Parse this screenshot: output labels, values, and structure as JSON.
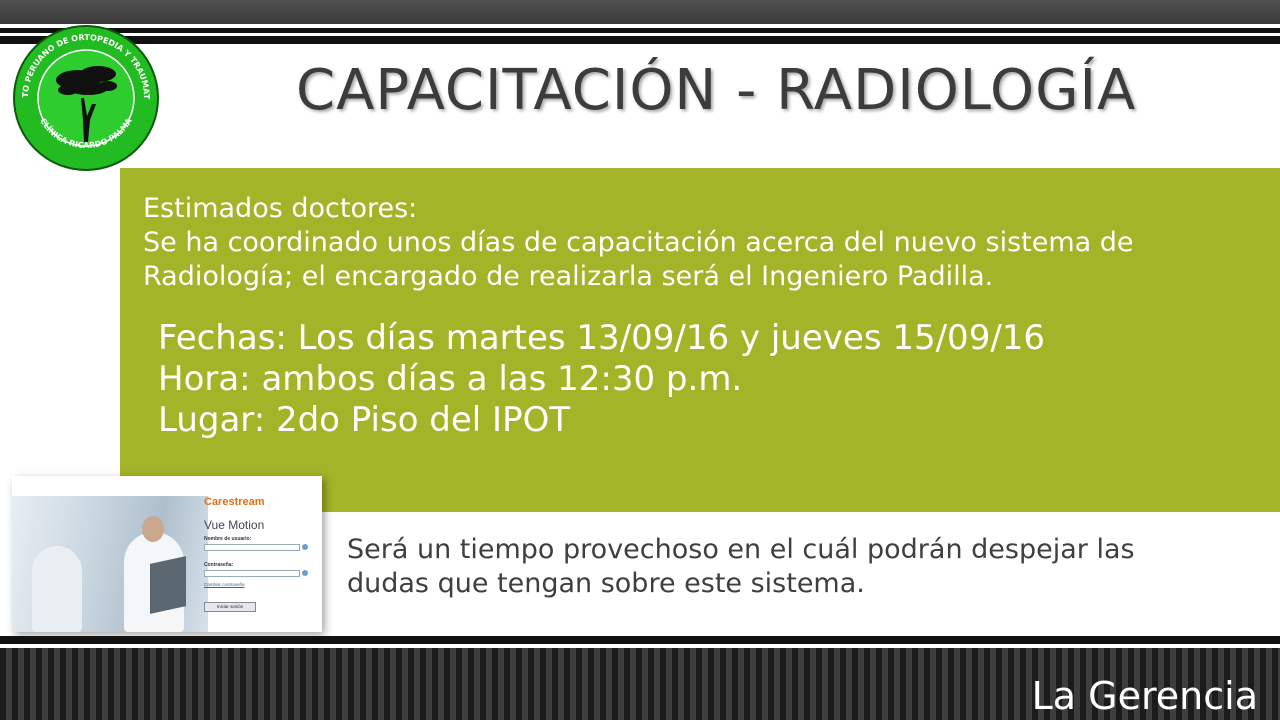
{
  "logo": {
    "outer_text": "INSTITUTO PERUANO DE ORTOPEDIA Y TRAUMATOLOGÍA",
    "bottom_text": "CLÍNICA RICARDO PALMA",
    "color": "#22bb22"
  },
  "header": {
    "title": "CAPACITACIÓN - RADIOLOGÍA"
  },
  "announcement": {
    "greeting": "Estimados doctores:",
    "line1": "Se ha coordinado unos días de capacitación acerca del nuevo sistema de",
    "line2": "Radiología; el encargado de realizarla será el Ingeniero Padilla.",
    "fechas": "Fechas: Los días martes 13/09/16 y jueves 15/09/16",
    "hora": "Hora: ambos días a las 12:30 p.m.",
    "lugar": "Lugar: 2do Piso del IPOT",
    "panel_color": "#a2b427"
  },
  "screenshot": {
    "brand": "Carestream",
    "product": "Vue Motion",
    "username_label": "Nombre de usuario:",
    "password_label": "Contraseña:",
    "change_password": "Cambiar contraseña",
    "login_button": "Iniciar sesión"
  },
  "closing": {
    "line1": "Será un tiempo provechoso en el cuál podrán despejar las",
    "line2": "dudas que tengan sobre este sistema."
  },
  "footer": {
    "signature": "La Gerencia"
  }
}
